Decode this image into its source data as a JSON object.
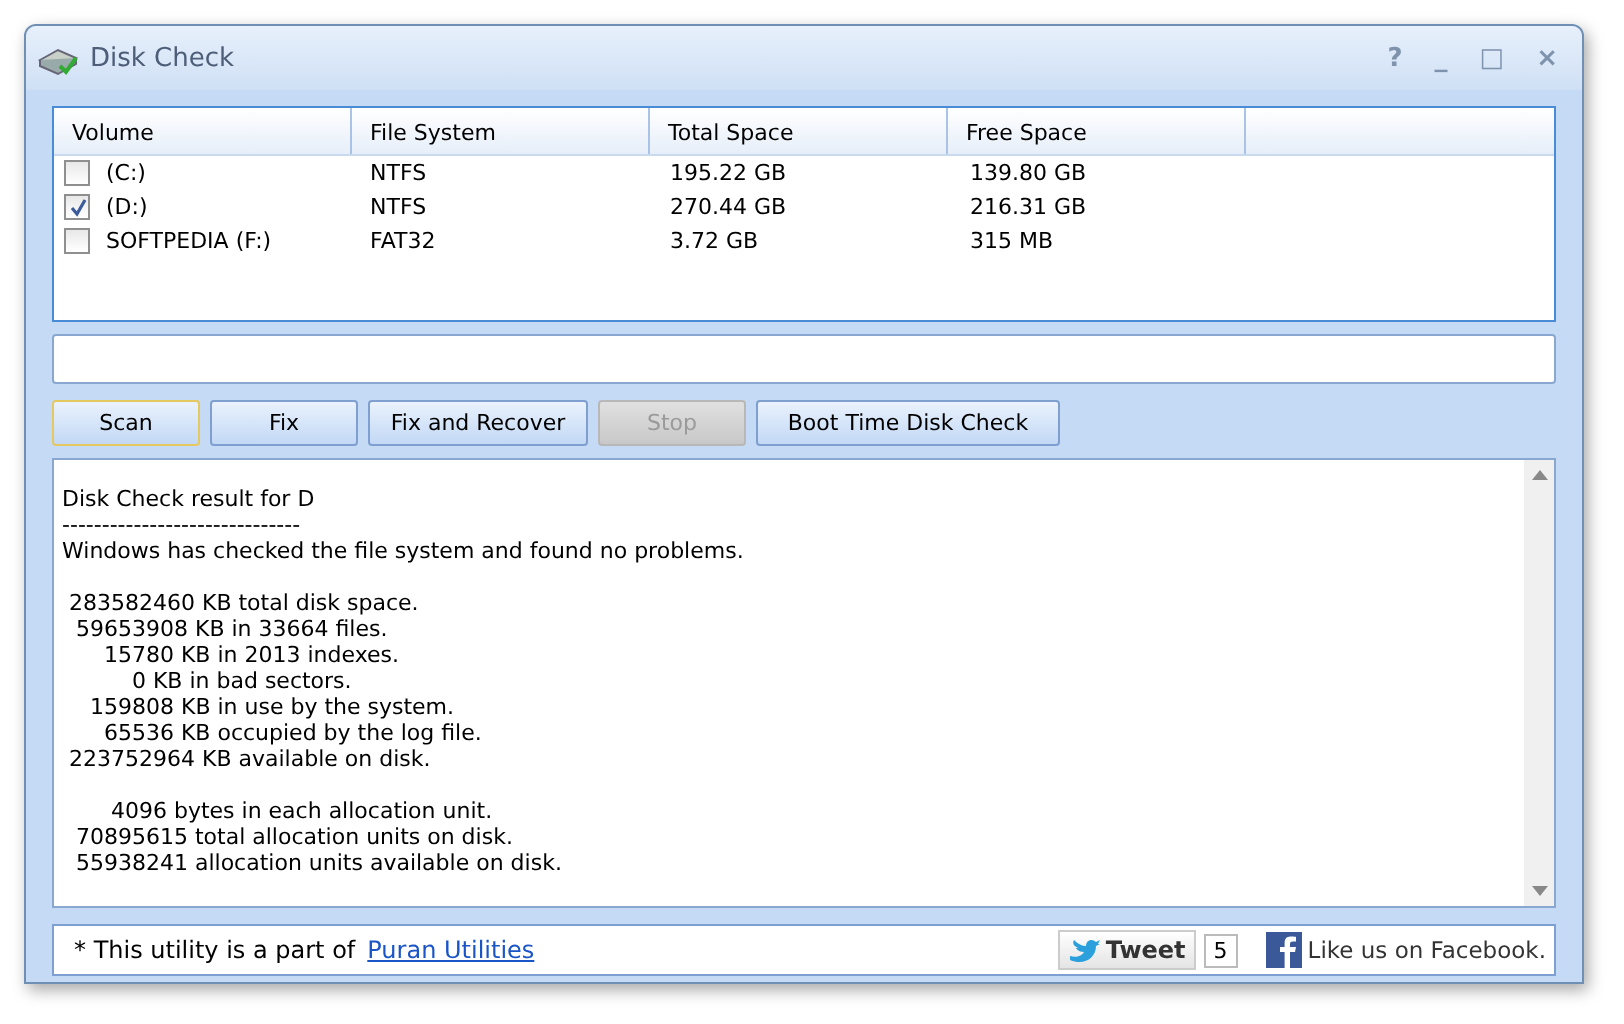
{
  "window": {
    "title": "Disk Check",
    "controls": [
      "?",
      "_",
      "□",
      "×"
    ]
  },
  "table": {
    "columns": [
      "Volume",
      "File System",
      "Total Space",
      "Free Space"
    ],
    "rows": [
      {
        "checked": false,
        "cells": [
          "(C:)",
          "NTFS",
          "195.22 GB",
          "139.80 GB"
        ]
      },
      {
        "checked": true,
        "cells": [
          "(D:)",
          "NTFS",
          "270.44 GB",
          "216.31 GB"
        ]
      },
      {
        "checked": false,
        "cells": [
          "SOFTPEDIA (F:)",
          "FAT32",
          "3.72 GB",
          "315 MB"
        ]
      }
    ]
  },
  "buttons": [
    {
      "label": "Scan",
      "disabled": false,
      "focused": true
    },
    {
      "label": "Fix",
      "disabled": false,
      "focused": false
    },
    {
      "label": "Fix and Recover",
      "disabled": false,
      "focused": false
    },
    {
      "label": "Stop",
      "disabled": true,
      "focused": false
    },
    {
      "label": "Boot Time Disk Check",
      "disabled": false,
      "focused": false
    }
  ],
  "result": {
    "paragraphs": [
      [
        "Disk Check result for D",
        "------------------------------",
        "Windows has checked the file system and found no problems."
      ],
      [
        " 283582460 KB total disk space.",
        "  59653908 KB in 33664 files.",
        "      15780 KB in 2013 indexes.",
        "          0 KB in bad sectors.",
        "    159808 KB in use by the system.",
        "      65536 KB occupied by the log file.",
        " 223752964 KB available on disk."
      ],
      [
        "       4096 bytes in each allocation unit.",
        "  70895615 total allocation units on disk.",
        "  55938241 allocation units available on disk."
      ]
    ]
  },
  "footer": {
    "note": "* This utility is a part of",
    "link": "Puran Utilities",
    "tweet": "Tweet",
    "tweet_count": "5",
    "facebook": "Like us on Facebook."
  }
}
